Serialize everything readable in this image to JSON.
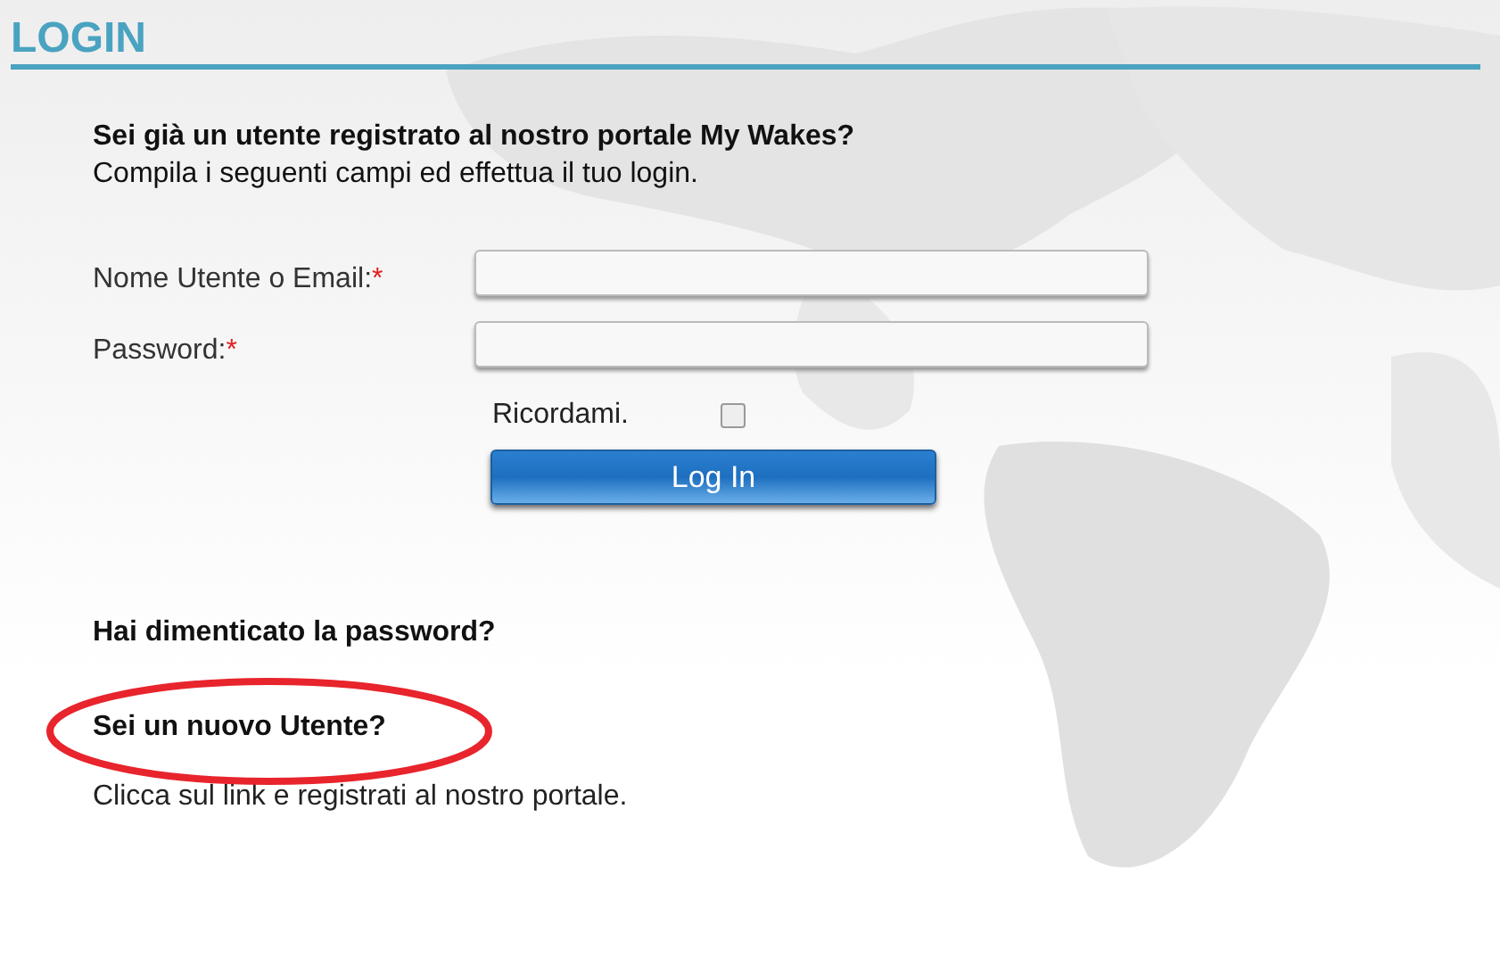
{
  "title": "LOGIN",
  "intro": {
    "heading": "Sei già un utente registrato al nostro portale My Wakes?",
    "text": "Compila i seguenti campi ed effettua il tuo login."
  },
  "fields": [
    {
      "label": "Nome Utente o Email:",
      "required_mark": "*"
    },
    {
      "label": "Password:",
      "required_mark": "*"
    }
  ],
  "remember": {
    "label": "Ricordami.",
    "checked": false
  },
  "login_button": "Log In",
  "forgot": "Hai dimenticato la password?",
  "new_user": {
    "heading": "Sei un nuovo Utente?",
    "highlighted": true,
    "text": "Clicca sul link e registrati al nostro portale."
  }
}
